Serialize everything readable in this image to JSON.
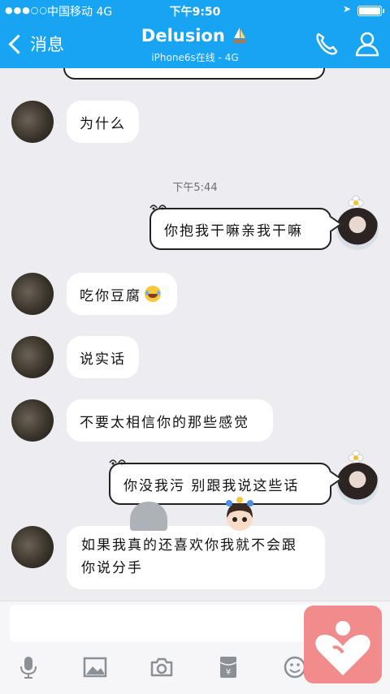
{
  "status_bar": {
    "signal": "●●●○○",
    "carrier": "中国移动  4G",
    "time": "下午9:50"
  },
  "nav": {
    "back_label": "消息",
    "title": "Delusion",
    "subtitle": "iPhone6s在线 - 4G"
  },
  "timestamp": "下午5:44",
  "messages": [
    {
      "sender": "other",
      "text": "为什么"
    },
    {
      "sender": "me",
      "text": "你抱我干嘛亲我干嘛"
    },
    {
      "sender": "other",
      "text": "吃你豆腐"
    },
    {
      "sender": "other",
      "text": "说实话"
    },
    {
      "sender": "other",
      "text": "不要太相信你的那些感觉"
    },
    {
      "sender": "me",
      "text": "你没我污  别跟我说这些话"
    },
    {
      "sender": "other",
      "line1": "如果我真的还喜欢你我就不会跟",
      "line2": "你说分手"
    }
  ],
  "toolbar": [
    "mic-icon",
    "image-icon",
    "camera-icon",
    "red-packet-icon",
    "emoji-icon"
  ],
  "colors": {
    "nav": "#17a4f2",
    "background": "#ececf1",
    "badge": "#f28b8b"
  }
}
